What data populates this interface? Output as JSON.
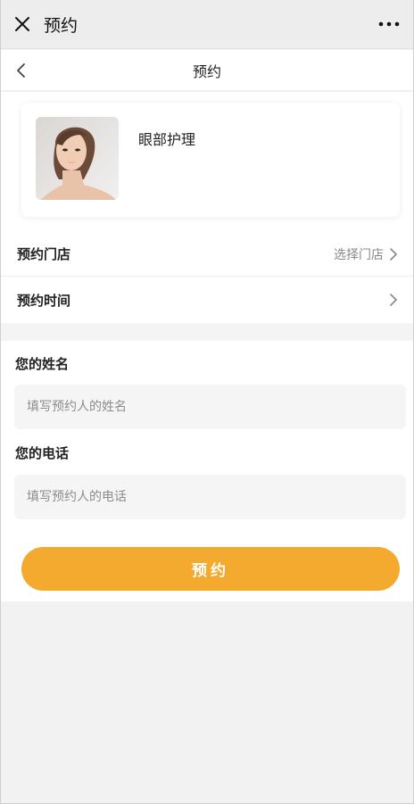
{
  "window": {
    "title": "预约",
    "close_icon": "close-icon",
    "more_icon": "more-icon"
  },
  "navbar": {
    "title": "预约",
    "back_icon": "chevron-left-icon"
  },
  "product": {
    "name": "眼部护理",
    "image": "woman-portrait-image"
  },
  "store_row": {
    "label": "预约门店",
    "value": "选择门店",
    "icon": "chevron-right-icon"
  },
  "time_row": {
    "label": "预约时间",
    "value": "",
    "icon": "chevron-right-icon"
  },
  "form": {
    "name_label": "您的姓名",
    "name_placeholder": "填写预约人的姓名",
    "phone_label": "您的电话",
    "phone_placeholder": "填写预约人的电话"
  },
  "submit": {
    "label": "预约"
  },
  "colors": {
    "accent": "#f4a92f",
    "background": "#f2f2f2",
    "topbar": "#ededed"
  }
}
